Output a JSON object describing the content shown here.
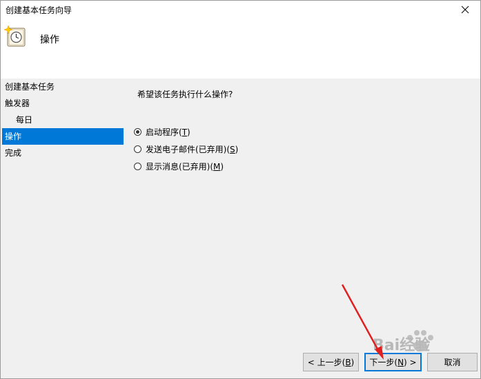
{
  "window": {
    "title": "创建基本任务向导",
    "close_glyph": "✕"
  },
  "header": {
    "icon": "task-scheduler-clock-icon",
    "title": "操作"
  },
  "steps": [
    {
      "label": "创建基本任务",
      "active": false,
      "sub": false
    },
    {
      "label": "触发器",
      "active": false,
      "sub": false
    },
    {
      "label": "每日",
      "active": false,
      "sub": true
    },
    {
      "label": "操作",
      "active": true,
      "sub": false
    },
    {
      "label": "完成",
      "active": false,
      "sub": false
    }
  ],
  "main": {
    "question": "希望该任务执行什么操作?",
    "options": [
      {
        "label": "启动程序(",
        "accel": "T",
        "suffix": ")",
        "checked": true
      },
      {
        "label": "发送电子邮件(已弃用)(",
        "accel": "S",
        "suffix": ")",
        "checked": false
      },
      {
        "label": "显示消息(已弃用)(",
        "accel": "M",
        "suffix": ")",
        "checked": false
      }
    ]
  },
  "buttons": {
    "back": {
      "label": "< 上一步(",
      "accel": "B",
      "suffix": ")"
    },
    "next": {
      "label": "下一步(",
      "accel": "N",
      "suffix": ") >"
    },
    "cancel": {
      "label": "取消"
    }
  },
  "watermark": {
    "text": "Bai经验"
  },
  "colors": {
    "accent": "#0078d7",
    "panel": "#f0f0f0",
    "annotation_arrow": "#e02020"
  }
}
